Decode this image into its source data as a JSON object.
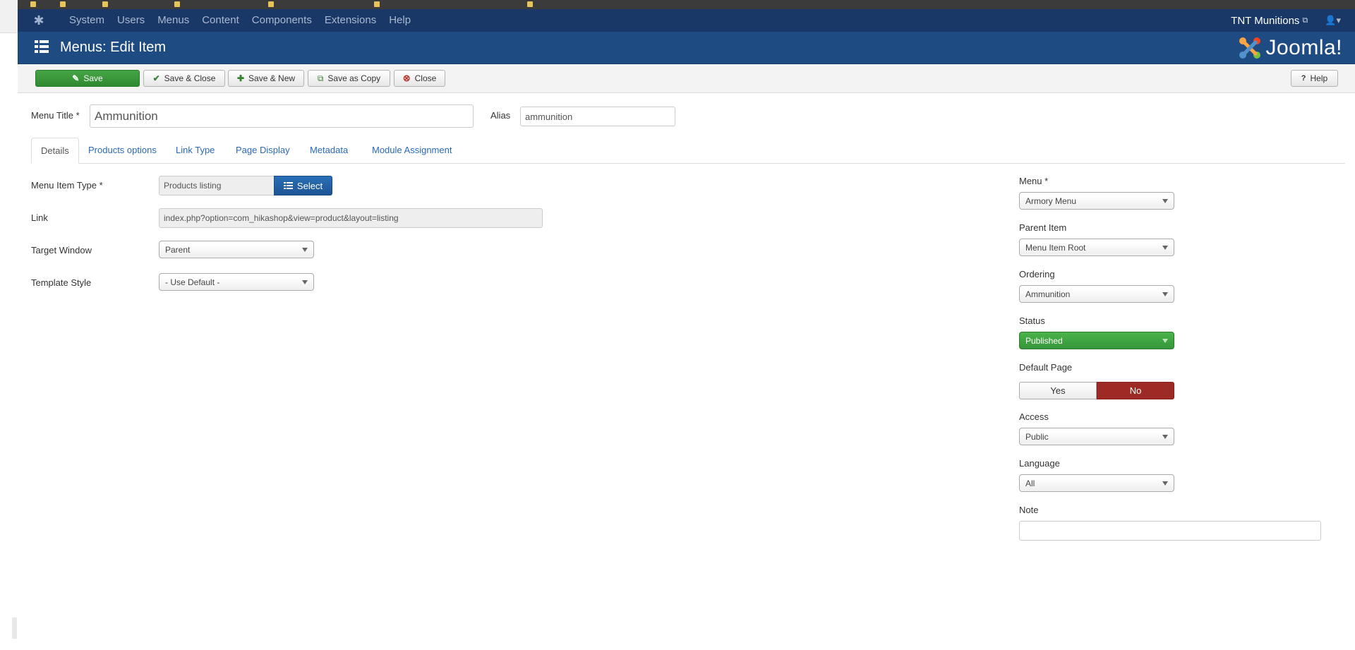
{
  "navbar": {
    "menu": [
      "System",
      "Users",
      "Menus",
      "Content",
      "Components",
      "Extensions",
      "Help"
    ],
    "site_name": "TNT Munitions"
  },
  "header": {
    "title": "Menus: Edit Item",
    "logo_text": "Joomla!"
  },
  "toolbar": {
    "save": "Save",
    "save_close": "Save & Close",
    "save_new": "Save & New",
    "save_copy": "Save as Copy",
    "close": "Close",
    "help": "Help"
  },
  "title_row": {
    "menu_title_label": "Menu Title *",
    "menu_title_value": "Ammunition",
    "alias_label": "Alias",
    "alias_value": "ammunition"
  },
  "tabs": [
    "Details",
    "Products options",
    "Link Type",
    "Page Display",
    "Metadata",
    "Module Assignment"
  ],
  "details": {
    "menu_item_type_label": "Menu Item Type *",
    "menu_item_type_value": "Products listing",
    "select_button": "Select",
    "link_label": "Link",
    "link_value": "index.php?option=com_hikashop&view=product&layout=listing",
    "target_window_label": "Target Window",
    "target_window_value": "Parent",
    "template_style_label": "Template Style",
    "template_style_value": "- Use Default -"
  },
  "sidebar": {
    "menu_label": "Menu *",
    "menu_value": "Armory Menu",
    "parent_label": "Parent Item",
    "parent_value": "Menu Item Root",
    "ordering_label": "Ordering",
    "ordering_value": "Ammunition",
    "status_label": "Status",
    "status_value": "Published",
    "default_page_label": "Default Page",
    "default_yes": "Yes",
    "default_no": "No",
    "access_label": "Access",
    "access_value": "Public",
    "language_label": "Language",
    "language_value": "All",
    "note_label": "Note",
    "note_value": ""
  },
  "colors": {
    "navbar": "#1a3867",
    "header": "#1d4b82",
    "save_green": "#46a546",
    "no_red": "#9d2a24",
    "link_blue": "#2a69b8"
  }
}
